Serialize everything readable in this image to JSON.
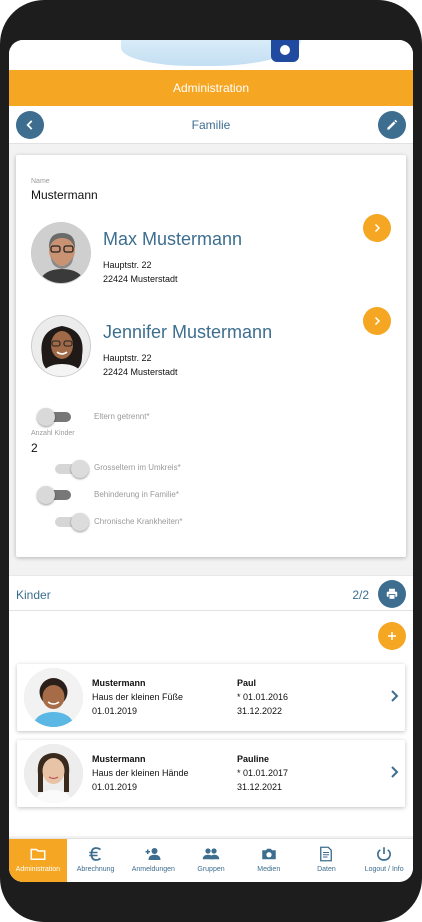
{
  "appbar": {
    "title": "Administration"
  },
  "subbar": {
    "title": "Familie"
  },
  "family": {
    "name_label": "Name",
    "name": "Mustermann",
    "parents": [
      {
        "name": "Max Mustermann",
        "street": "Hauptstr. 22",
        "city": "22424 Musterstadt"
      },
      {
        "name": "Jennifer Mustermann",
        "street": "Hauptstr. 22",
        "city": "22424 Musterstadt"
      }
    ],
    "toggles": {
      "eltern_getrennt": "Eltern getrennt*",
      "grosseltern": "Grosseltern im Umkreis*",
      "behinderung": "Behinderung in Familie*",
      "chronisch": "Chronische Krankheiten*"
    },
    "anzahl_kinder_label": "Anzahl Kinder",
    "anzahl_kinder": "2"
  },
  "kinder": {
    "title": "Kinder",
    "count": "2/2",
    "children": [
      {
        "lastname": "Mustermann",
        "firstname": "Paul",
        "kita": "Haus der kleinen Füße",
        "birth": "* 01.01.2016",
        "start": "01.01.2019",
        "end": "31.12.2022"
      },
      {
        "lastname": "Mustermann",
        "firstname": "Pauline",
        "kita": "Haus der kleinen Hände",
        "birth": "* 01.01.2017",
        "start": "01.01.2019",
        "end": "31.12.2021"
      }
    ]
  },
  "tabs": [
    {
      "label": "Administration",
      "icon": "folder-icon"
    },
    {
      "label": "Abrechnung",
      "icon": "euro-icon"
    },
    {
      "label": "Anmeldungen",
      "icon": "person-add-icon"
    },
    {
      "label": "Gruppen",
      "icon": "group-icon"
    },
    {
      "label": "Medien",
      "icon": "camera-icon"
    },
    {
      "label": "Daten",
      "icon": "document-icon"
    },
    {
      "label": "Logout / Info",
      "icon": "power-icon"
    }
  ],
  "colors": {
    "accent": "#f5a623",
    "primary": "#3d6e8f",
    "frame": "#1d1d1d"
  }
}
